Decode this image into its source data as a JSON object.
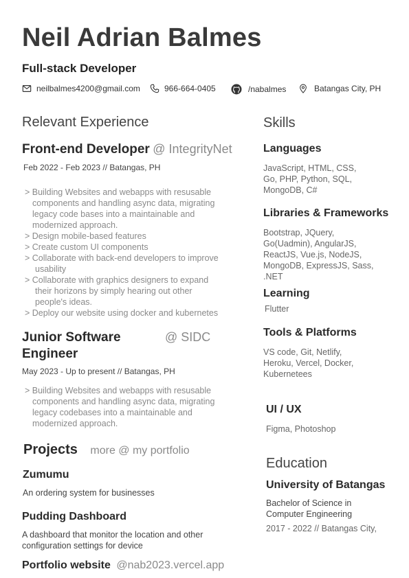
{
  "header": {
    "name": "Neil Adrian Balmes",
    "role": "Full-stack Developer",
    "contact": {
      "email": "neilbalmes4200@gmail.com",
      "phone": "966-664-0405",
      "github": "/nabalmes",
      "location": "Batangas City, PH"
    }
  },
  "experience": {
    "heading": "Relevant Experience",
    "jobs": [
      {
        "title": "Front-end Developer",
        "company": "@ IntegrityNet",
        "meta": "Feb 2022 - Feb 2023  //  Batangas, PH",
        "bullets": [
          [
            ">  Building Websites and webapps with resusable",
            "components and handling async data, migrating",
            "legacy code bases into a maintainable and",
            "modernized approach."
          ],
          [
            ">  Design mobile-based features"
          ],
          [
            ">  Create custom UI components"
          ],
          [
            ">  Collaborate with back-end developers to improve",
            "usability"
          ],
          [
            ">  Collaborate with graphics designers to expand",
            "their horizons by simply hearing out other",
            "people's ideas."
          ],
          [
            ">   Deploy our website using docker and kubernetes"
          ]
        ]
      },
      {
        "title_line1": "Junior Software",
        "title_line2": "Engineer",
        "company": "@ SIDC",
        "meta": "May 2023 - Up to present  //  Batangas, PH",
        "bullets": [
          [
            ">  Building Websites and webapps with resusable",
            "components and handling async data, migrating",
            "legacy codebases into a maintainable and",
            "modernized approach."
          ]
        ]
      }
    ]
  },
  "projects": {
    "heading": "Projects",
    "link": "more @ my portfolio",
    "items": [
      {
        "title": "Zumumu",
        "desc": [
          "An ordering system for businesses"
        ]
      },
      {
        "title": "Pudding Dashboard",
        "desc": [
          "A dashboard that monitor the location and other",
          "configuration settings for device"
        ]
      },
      {
        "title": "Portfolio website",
        "link": "@nab2023.vercel.app"
      }
    ]
  },
  "skills": {
    "heading": "Skills",
    "groups": [
      {
        "title": "Languages",
        "lines": [
          "JavaScript,   HTML,   CSS,",
          "Go,  PHP, Python,  SQL,",
          "MongoDB, C#"
        ]
      },
      {
        "title": "Libraries & Frameworks",
        "lines": [
          "Bootstrap, JQuery,",
          "Go(Uadmin), AngularJS,",
          "ReactJS, Vue.js,  NodeJS,",
          "MongoDB, ExpressJS, Sass,",
          ".NET"
        ]
      },
      {
        "title": "Learning",
        "lines": [
          "Flutter"
        ]
      },
      {
        "title": "Tools & Platforms",
        "lines": [
          "VS code,  Git,  Netlify,",
          "Heroku, Vercel,    Docker,",
          "Kubernetees"
        ]
      },
      {
        "title": "UI / UX",
        "lines": [
          "Figma,    Photoshop"
        ]
      }
    ]
  },
  "education": {
    "heading": "Education",
    "school": "University of Batangas",
    "degree": [
      "Bachelor of Science in",
      "Computer Engineering"
    ],
    "meta": "2017 - 2022  //  Batangas City,"
  },
  "icons": [
    "mail-icon",
    "phone-icon",
    "github-icon",
    "location-pin-icon"
  ]
}
